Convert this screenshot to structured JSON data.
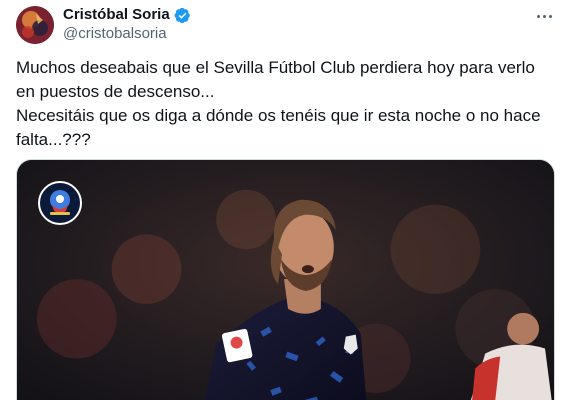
{
  "author": {
    "display_name": "Cristóbal Soria",
    "handle": "@cristobalsoria",
    "verified": true
  },
  "tweet": {
    "text": "Muchos deseabais que el Sevilla Fútbol Club perdiera hoy para verlo en puestos de descenso...\nNecesitáis que os diga a dónde os tenéis que ir esta noche o no hace falta...???"
  },
  "media": {
    "type": "photo",
    "watermark_icon": "channel-logo-icon",
    "jersey_sponsor": "LaLiga"
  },
  "icons": {
    "verified": "verified-badge-icon",
    "more": "more-options-icon"
  },
  "colors": {
    "verified_blue": "#1d9bf0",
    "secondary_text": "#536471",
    "border": "#cfd9de"
  }
}
